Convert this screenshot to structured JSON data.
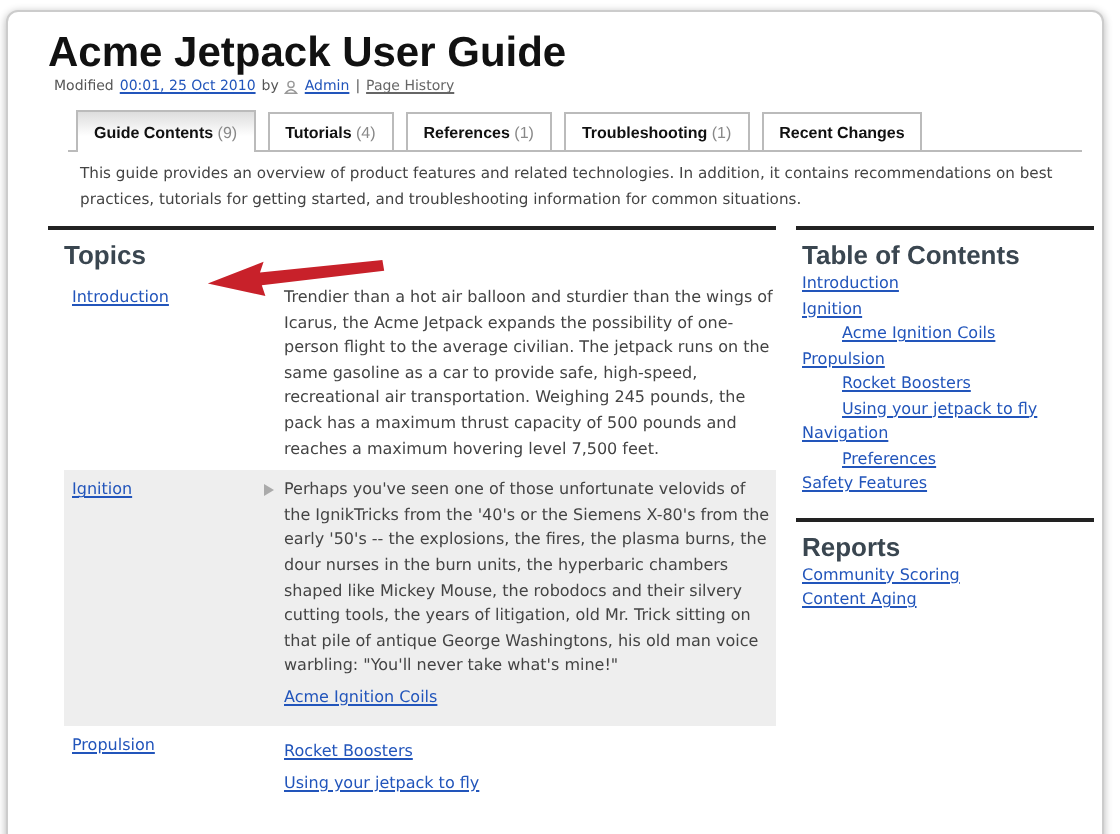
{
  "page": {
    "title": "Acme Jetpack User Guide"
  },
  "meta": {
    "prefix": "Modified",
    "date_link": "00:01, 25 Oct 2010",
    "by": "by",
    "author": "Admin",
    "separator": "|",
    "history_link": "Page History"
  },
  "tabs": [
    {
      "label": "Guide Contents",
      "count": "(9)",
      "selected": true
    },
    {
      "label": "Tutorials",
      "count": "(4)",
      "selected": false
    },
    {
      "label": "References",
      "count": "(1)",
      "selected": false
    },
    {
      "label": "Troubleshooting",
      "count": "(1)",
      "selected": false
    },
    {
      "label": "Recent Changes",
      "selected": false
    }
  ],
  "intro": "This guide provides an overview of product features and related technologies. In addition, it contains recommendations on best practices, tutorials for getting started, and troubleshooting information for common situations.",
  "topics": {
    "heading": "Topics",
    "rows": [
      {
        "link": "Introduction",
        "highlighted": false,
        "text": "Trendier than a hot air balloon and sturdier than the wings of Icarus, the Acme Jetpack expands the possibility of one-person flight to the average civilian. The jetpack runs on the same gasoline as a car to provide safe, high-speed, recreational air transportation. Weighing 245 pounds, the pack has a maximum thrust capacity of 500 pounds and reaches a maximum hovering level 7,500 feet."
      },
      {
        "link": "Ignition",
        "highlighted": true,
        "text": "Perhaps you've seen one of those unfortunate velovids of the IgnikTricks from the '40's or the Siemens X-80's from the early '50's -- the explosions, the fires, the plasma burns, the dour nurses in the burn units, the hyperbaric chambers shaped like Mickey Mouse, the robodocs and their silvery cutting tools, the years of litigation, old Mr. Trick sitting on that pile of antique George Washingtons, his old man voice warbling: \"You'll never take what's mine!\"",
        "links": [
          "Acme Ignition Coils"
        ]
      },
      {
        "link": "Propulsion",
        "highlighted": false,
        "links": [
          "Rocket Boosters",
          "Using your jetpack to fly"
        ]
      }
    ]
  },
  "toc": {
    "heading": "Table of Contents",
    "items": [
      {
        "label": "Introduction"
      },
      {
        "label": "Ignition",
        "children": [
          {
            "label": "Acme Ignition Coils"
          }
        ]
      },
      {
        "label": "Propulsion",
        "children": [
          {
            "label": "Rocket Boosters"
          },
          {
            "label": "Using your jetpack to fly"
          }
        ]
      },
      {
        "label": "Navigation",
        "children": [
          {
            "label": "Preferences"
          }
        ]
      },
      {
        "label": "Safety Features"
      }
    ]
  },
  "reports": {
    "heading": "Reports",
    "links": [
      "Community Scoring",
      "Content Aging"
    ]
  }
}
